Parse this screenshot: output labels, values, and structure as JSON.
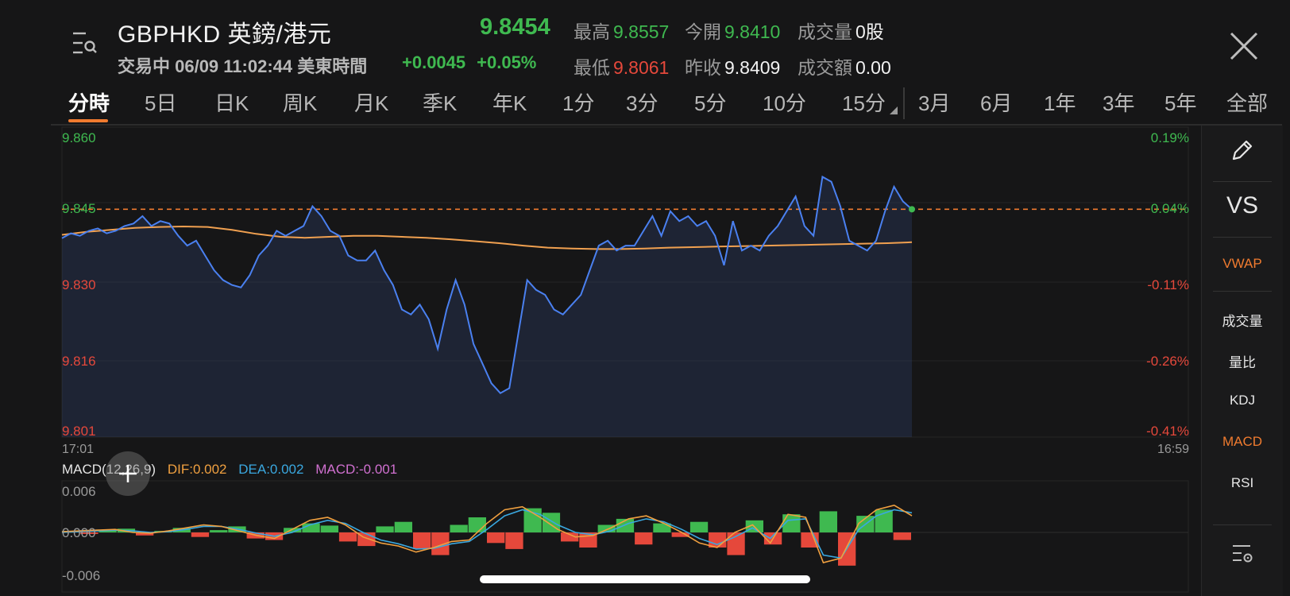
{
  "header": {
    "symbol_title": "GBPHKD 英鎊/港元",
    "last_price": "9.8454",
    "status": "交易中 06/09 11:02:44 美東時間",
    "change": "+0.0045",
    "change_pct": "+0.05%",
    "quotes": [
      {
        "label": "最高",
        "value": "9.8557",
        "tone": "green"
      },
      {
        "label": "今開",
        "value": "9.8410",
        "tone": "green"
      },
      {
        "label": "成交量",
        "value": "0股",
        "tone": "white"
      },
      {
        "label": "最低",
        "value": "9.8061",
        "tone": "red"
      },
      {
        "label": "昨收",
        "value": "9.8409",
        "tone": "white"
      },
      {
        "label": "成交額",
        "value": "0.00",
        "tone": "white"
      }
    ]
  },
  "tabs": [
    "分時",
    "5日",
    "日K",
    "周K",
    "月K",
    "季K",
    "年K",
    "1分",
    "3分",
    "5分",
    "10分",
    "15分",
    "3月",
    "6月",
    "1年",
    "3年",
    "5年",
    "全部"
  ],
  "active_tab": "分時",
  "right_panel": {
    "vs_label": "VS",
    "items": [
      "VWAP",
      "成交量",
      "量比",
      "KDJ",
      "MACD",
      "RSI"
    ],
    "active_items": [
      "VWAP",
      "MACD"
    ]
  },
  "colors": {
    "up": "#3fb950",
    "down": "#e5483b",
    "price_line": "#4a80f0",
    "avg_line": "#f0a050",
    "accent": "#f07b2f",
    "dif": "#f0a040",
    "dea": "#3aa8e0",
    "macd_label": "#d070d0"
  },
  "chart_data": [
    {
      "type": "line",
      "title": "",
      "x_start_label": "17:01",
      "x_end_label": "16:59",
      "y_ticks": [
        "9.860",
        "9.845",
        "9.830",
        "9.816",
        "9.801"
      ],
      "y_pct_ticks": [
        "0.19%",
        "0.04%",
        "-0.11%",
        "-0.26%",
        "-0.41%"
      ],
      "ylim": [
        9.801,
        9.86
      ],
      "reference_value": 9.8454,
      "series": [
        {
          "name": "",
          "values": [
            9.8395,
            9.8405,
            9.84,
            9.841,
            9.8415,
            9.8405,
            9.841,
            9.842,
            9.8425,
            9.844,
            9.842,
            9.843,
            9.8425,
            9.84,
            9.838,
            9.839,
            9.836,
            9.833,
            9.831,
            9.83,
            9.8295,
            9.832,
            9.836,
            9.838,
            9.841,
            9.84,
            9.841,
            9.842,
            9.846,
            9.844,
            9.841,
            9.84,
            9.836,
            9.835,
            9.835,
            9.837,
            9.833,
            9.83,
            9.825,
            9.824,
            9.826,
            9.823,
            9.817,
            9.825,
            9.831,
            9.826,
            9.818,
            9.814,
            9.81,
            9.808,
            9.809,
            9.82,
            9.831,
            9.829,
            9.828,
            9.825,
            9.824,
            9.826,
            9.828,
            9.833,
            9.838,
            9.839,
            9.837,
            9.838,
            9.838,
            9.841,
            9.844,
            9.84,
            9.845,
            9.843,
            9.844,
            9.842,
            9.843,
            9.84,
            9.834,
            9.843,
            9.837,
            9.838,
            9.837,
            9.84,
            9.842,
            9.845,
            9.848,
            9.842,
            9.84,
            9.852,
            9.851,
            9.846,
            9.839,
            9.838,
            9.837,
            9.839,
            9.845,
            9.85,
            9.847,
            9.8454
          ],
          "color": "#4a80f0"
        },
        {
          "name": "VWAP",
          "values": [
            9.8402,
            9.8408,
            9.8412,
            9.8416,
            9.8418,
            9.8419,
            9.8418,
            9.8412,
            9.8404,
            9.8398,
            9.8396,
            9.8398,
            9.84,
            9.84,
            9.8398,
            9.8396,
            9.8393,
            9.8389,
            9.8385,
            9.838,
            9.8376,
            9.8374,
            9.8373,
            9.8373,
            9.8374,
            9.8376,
            9.8377,
            9.8378,
            9.8379,
            9.838,
            9.8381,
            9.8382,
            9.8383,
            9.8384,
            9.8385,
            9.8387
          ],
          "color": "#f0a050"
        }
      ]
    },
    {
      "type": "bar",
      "title": "MACD(12,26,9)",
      "indicators": {
        "dif_label": "DIF:0.002",
        "dea_label": "DEA:0.002",
        "macd_label": "MACD:-0.001"
      },
      "y_ticks": [
        "0.006",
        "0.000",
        "-0.006"
      ],
      "ylim": [
        -0.006,
        0.006
      ],
      "series": [
        {
          "name": "MACD",
          "values": [
            0.0002,
            -0.0002,
            0.0003,
            0.0005,
            -0.0004,
            0.0002,
            0.0006,
            -0.0006,
            0.0003,
            0.0008,
            -0.0008,
            -0.001,
            0.0006,
            0.0012,
            0.0009,
            -0.0012,
            -0.0018,
            0.0008,
            0.0014,
            -0.0022,
            -0.003,
            0.001,
            0.002,
            -0.0014,
            -0.0022,
            0.0032,
            0.0026,
            -0.0012,
            -0.002,
            0.001,
            0.0018,
            -0.0016,
            0.0012,
            -0.0006,
            0.0014,
            -0.002,
            -0.003,
            0.0016,
            -0.0016,
            0.0024,
            -0.002,
            0.0028,
            -0.0044,
            0.0022,
            0.003,
            -0.001
          ]
        },
        {
          "name": "DIF",
          "values": [
            0.0001,
            0.0002,
            0.0003,
            0.0004,
            0.0,
            -0.0001,
            0.0002,
            0.0006,
            0.001,
            0.0008,
            0.0002,
            -0.0004,
            -0.0008,
            0.0004,
            0.0016,
            0.002,
            0.001,
            -0.0006,
            -0.0014,
            -0.0018,
            -0.0026,
            -0.002,
            -0.0012,
            -0.001,
            0.0012,
            0.003,
            0.0034,
            0.002,
            0.0004,
            -0.0006,
            -0.0004,
            0.0006,
            0.0018,
            0.0022,
            0.0012,
            0.0,
            -0.0014,
            -0.002,
            0.0,
            0.001,
            -0.0014,
            0.0024,
            0.002,
            -0.004,
            -0.0034,
            0.0012,
            0.003,
            0.0036,
            0.0022
          ]
        },
        {
          "name": "DEA",
          "values": [
            0.0,
            0.0001,
            0.0002,
            0.0003,
            0.0002,
            0.0,
            0.0001,
            0.0004,
            0.0008,
            0.0008,
            0.0004,
            -0.0001,
            -0.0005,
            0.0,
            0.001,
            0.0016,
            0.0012,
            0.0,
            -0.001,
            -0.0015,
            -0.0022,
            -0.0021,
            -0.0015,
            -0.0012,
            0.0004,
            0.0022,
            0.003,
            0.0024,
            0.001,
            0.0,
            -0.0003,
            0.0002,
            0.0012,
            0.0018,
            0.0014,
            0.0004,
            -0.0008,
            -0.0016,
            -0.0006,
            0.0006,
            -0.0008,
            0.0016,
            0.0018,
            -0.003,
            -0.0034,
            0.0004,
            0.0022,
            0.003,
            0.0026
          ]
        }
      ]
    }
  ]
}
